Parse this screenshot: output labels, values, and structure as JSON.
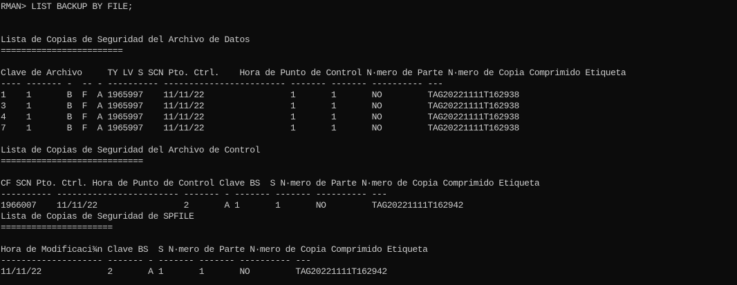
{
  "terminal": {
    "prompt": "RMAN> LIST BACKUP BY FILE;",
    "datafiles": {
      "title": "Lista de Copias de Seguridad del Archivo de Datos",
      "underline": "========================",
      "header": "Clave de Archivo     TY LV S SCN Pto. Ctrl.    Hora de Punto de Control N·mero de Parte N·mero de Copia Comprimido Etiqueta",
      "separator": "---- ------- -  -- - ---------- ------------------------ ------- ------- ---------- ---",
      "rows": [
        "1    1       B  F  A 1965997    11/11/22                 1       1       NO         TAG20221111T162938",
        "3    1       B  F  A 1965997    11/11/22                 1       1       NO         TAG20221111T162938",
        "4    1       B  F  A 1965997    11/11/22                 1       1       NO         TAG20221111T162938",
        "7    1       B  F  A 1965997    11/11/22                 1       1       NO         TAG20221111T162938"
      ]
    },
    "controlfile": {
      "title": "Lista de Copias de Seguridad del Archivo de Control",
      "underline": "============================",
      "header": "CF SCN Pto. Ctrl. Hora de Punto de Control Clave BS  S N·mero de Parte N·mero de Copia Comprimido Etiqueta",
      "separator": "---------- ------------------------ ------- - ------- ------- ---------- ---",
      "rows": [
        "1966007    11/11/22                 2       A 1       1       NO         TAG20221111T162942"
      ]
    },
    "spfile": {
      "title": "Lista de Copias de Seguridad de SPFILE",
      "underline": "======================",
      "header": "Hora de Modificaci¾n Clave BS  S N·mero de Parte N·mero de Copia Comprimido Etiqueta",
      "separator": "-------------------- ------- - ------- ------- ---------- ---",
      "rows": [
        "11/11/22             2       A 1       1       NO         TAG20221111T162942"
      ]
    }
  }
}
